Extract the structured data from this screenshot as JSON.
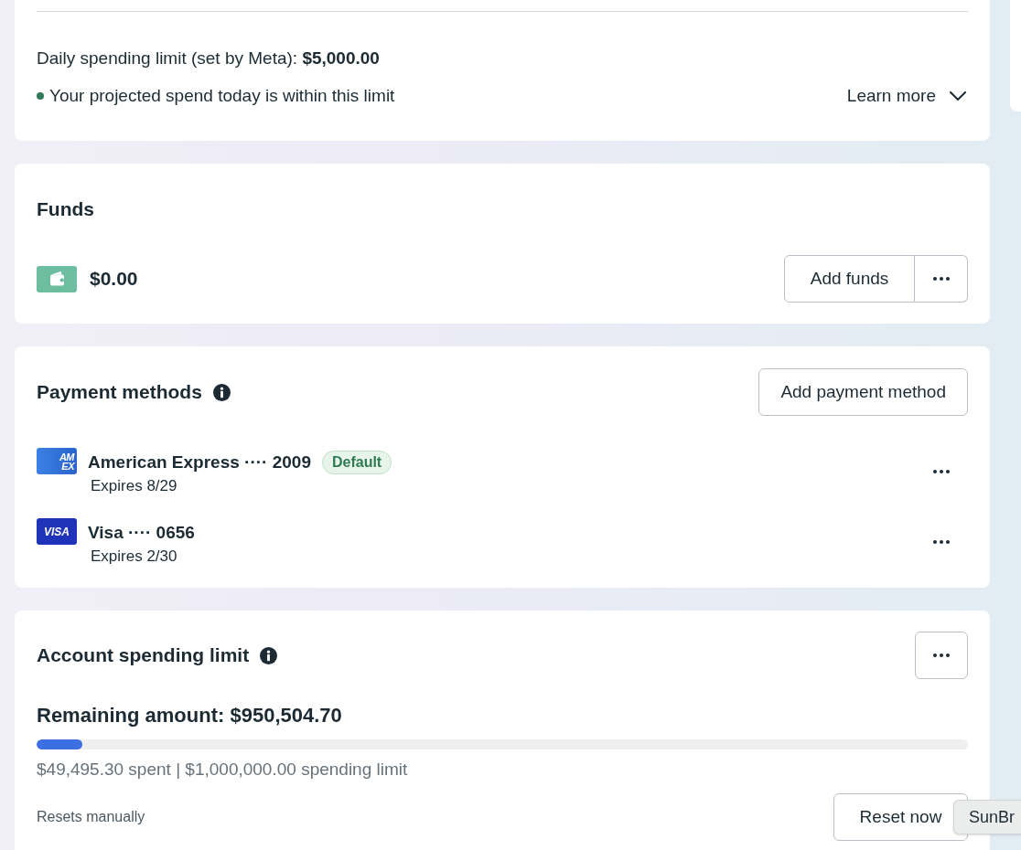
{
  "spending_summary": {
    "daily_limit": "Daily spending limit (set by Meta): **$5,000.00**",
    "status": {
      "text": "Your projected spend today is within this limit",
      "within_limit": true
    },
    "learn_more": {
      "label": "Learn more",
      "expanded": false
    }
  },
  "funds": {
    "title": "Funds",
    "balance": "$0.00",
    "add_button": "Add funds"
  },
  "payment_methods": {
    "title": "Payment methods",
    "add_button": "Add payment method",
    "methods": [
      {
        "kind": "amex",
        "logo": [
          "AM",
          "EX"
        ],
        "name": "American Express ···· 2009",
        "default": true,
        "badge": "Default",
        "expires": "Expires 8/29"
      },
      {
        "kind": "visa",
        "logo": [
          "VISA"
        ],
        "name": "Visa ···· 0656",
        "default": false,
        "expires": "Expires 2/30"
      }
    ]
  },
  "account_spending_limit": {
    "title": "Account spending limit",
    "remaining": "Remaining amount: $950,504.70",
    "level": 0.0495,
    "summary": "$49,495.30 spent | $1,000,000.00 spending limit",
    "reset_note": "Resets manually",
    "reset_button": "Reset now"
  },
  "tooltip": {
    "text": "SunBr"
  }
}
